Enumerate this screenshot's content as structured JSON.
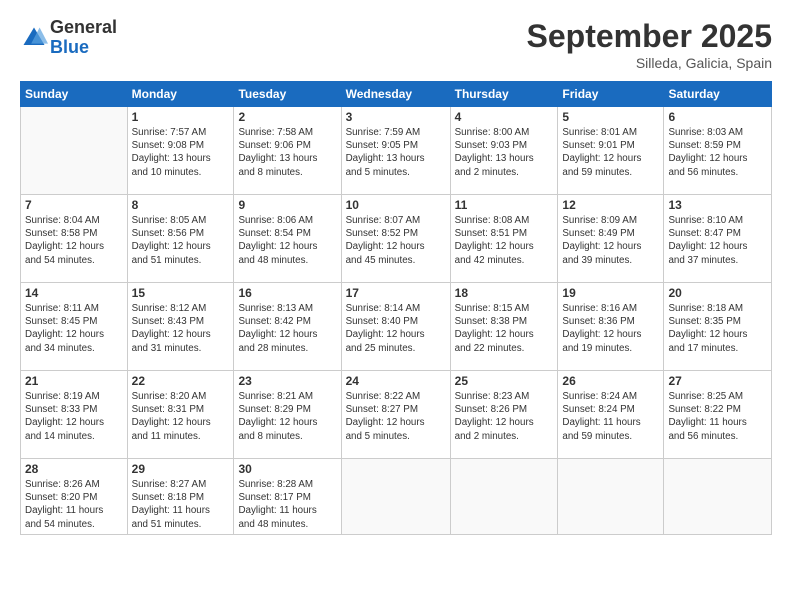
{
  "logo": {
    "general": "General",
    "blue": "Blue"
  },
  "title": {
    "month": "September 2025",
    "location": "Silleda, Galicia, Spain"
  },
  "headers": [
    "Sunday",
    "Monday",
    "Tuesday",
    "Wednesday",
    "Thursday",
    "Friday",
    "Saturday"
  ],
  "weeks": [
    [
      {
        "day": "",
        "info": ""
      },
      {
        "day": "1",
        "info": "Sunrise: 7:57 AM\nSunset: 9:08 PM\nDaylight: 13 hours\nand 10 minutes."
      },
      {
        "day": "2",
        "info": "Sunrise: 7:58 AM\nSunset: 9:06 PM\nDaylight: 13 hours\nand 8 minutes."
      },
      {
        "day": "3",
        "info": "Sunrise: 7:59 AM\nSunset: 9:05 PM\nDaylight: 13 hours\nand 5 minutes."
      },
      {
        "day": "4",
        "info": "Sunrise: 8:00 AM\nSunset: 9:03 PM\nDaylight: 13 hours\nand 2 minutes."
      },
      {
        "day": "5",
        "info": "Sunrise: 8:01 AM\nSunset: 9:01 PM\nDaylight: 12 hours\nand 59 minutes."
      },
      {
        "day": "6",
        "info": "Sunrise: 8:03 AM\nSunset: 8:59 PM\nDaylight: 12 hours\nand 56 minutes."
      }
    ],
    [
      {
        "day": "7",
        "info": "Sunrise: 8:04 AM\nSunset: 8:58 PM\nDaylight: 12 hours\nand 54 minutes."
      },
      {
        "day": "8",
        "info": "Sunrise: 8:05 AM\nSunset: 8:56 PM\nDaylight: 12 hours\nand 51 minutes."
      },
      {
        "day": "9",
        "info": "Sunrise: 8:06 AM\nSunset: 8:54 PM\nDaylight: 12 hours\nand 48 minutes."
      },
      {
        "day": "10",
        "info": "Sunrise: 8:07 AM\nSunset: 8:52 PM\nDaylight: 12 hours\nand 45 minutes."
      },
      {
        "day": "11",
        "info": "Sunrise: 8:08 AM\nSunset: 8:51 PM\nDaylight: 12 hours\nand 42 minutes."
      },
      {
        "day": "12",
        "info": "Sunrise: 8:09 AM\nSunset: 8:49 PM\nDaylight: 12 hours\nand 39 minutes."
      },
      {
        "day": "13",
        "info": "Sunrise: 8:10 AM\nSunset: 8:47 PM\nDaylight: 12 hours\nand 37 minutes."
      }
    ],
    [
      {
        "day": "14",
        "info": "Sunrise: 8:11 AM\nSunset: 8:45 PM\nDaylight: 12 hours\nand 34 minutes."
      },
      {
        "day": "15",
        "info": "Sunrise: 8:12 AM\nSunset: 8:43 PM\nDaylight: 12 hours\nand 31 minutes."
      },
      {
        "day": "16",
        "info": "Sunrise: 8:13 AM\nSunset: 8:42 PM\nDaylight: 12 hours\nand 28 minutes."
      },
      {
        "day": "17",
        "info": "Sunrise: 8:14 AM\nSunset: 8:40 PM\nDaylight: 12 hours\nand 25 minutes."
      },
      {
        "day": "18",
        "info": "Sunrise: 8:15 AM\nSunset: 8:38 PM\nDaylight: 12 hours\nand 22 minutes."
      },
      {
        "day": "19",
        "info": "Sunrise: 8:16 AM\nSunset: 8:36 PM\nDaylight: 12 hours\nand 19 minutes."
      },
      {
        "day": "20",
        "info": "Sunrise: 8:18 AM\nSunset: 8:35 PM\nDaylight: 12 hours\nand 17 minutes."
      }
    ],
    [
      {
        "day": "21",
        "info": "Sunrise: 8:19 AM\nSunset: 8:33 PM\nDaylight: 12 hours\nand 14 minutes."
      },
      {
        "day": "22",
        "info": "Sunrise: 8:20 AM\nSunset: 8:31 PM\nDaylight: 12 hours\nand 11 minutes."
      },
      {
        "day": "23",
        "info": "Sunrise: 8:21 AM\nSunset: 8:29 PM\nDaylight: 12 hours\nand 8 minutes."
      },
      {
        "day": "24",
        "info": "Sunrise: 8:22 AM\nSunset: 8:27 PM\nDaylight: 12 hours\nand 5 minutes."
      },
      {
        "day": "25",
        "info": "Sunrise: 8:23 AM\nSunset: 8:26 PM\nDaylight: 12 hours\nand 2 minutes."
      },
      {
        "day": "26",
        "info": "Sunrise: 8:24 AM\nSunset: 8:24 PM\nDaylight: 11 hours\nand 59 minutes."
      },
      {
        "day": "27",
        "info": "Sunrise: 8:25 AM\nSunset: 8:22 PM\nDaylight: 11 hours\nand 56 minutes."
      }
    ],
    [
      {
        "day": "28",
        "info": "Sunrise: 8:26 AM\nSunset: 8:20 PM\nDaylight: 11 hours\nand 54 minutes."
      },
      {
        "day": "29",
        "info": "Sunrise: 8:27 AM\nSunset: 8:18 PM\nDaylight: 11 hours\nand 51 minutes."
      },
      {
        "day": "30",
        "info": "Sunrise: 8:28 AM\nSunset: 8:17 PM\nDaylight: 11 hours\nand 48 minutes."
      },
      {
        "day": "",
        "info": ""
      },
      {
        "day": "",
        "info": ""
      },
      {
        "day": "",
        "info": ""
      },
      {
        "day": "",
        "info": ""
      }
    ]
  ]
}
